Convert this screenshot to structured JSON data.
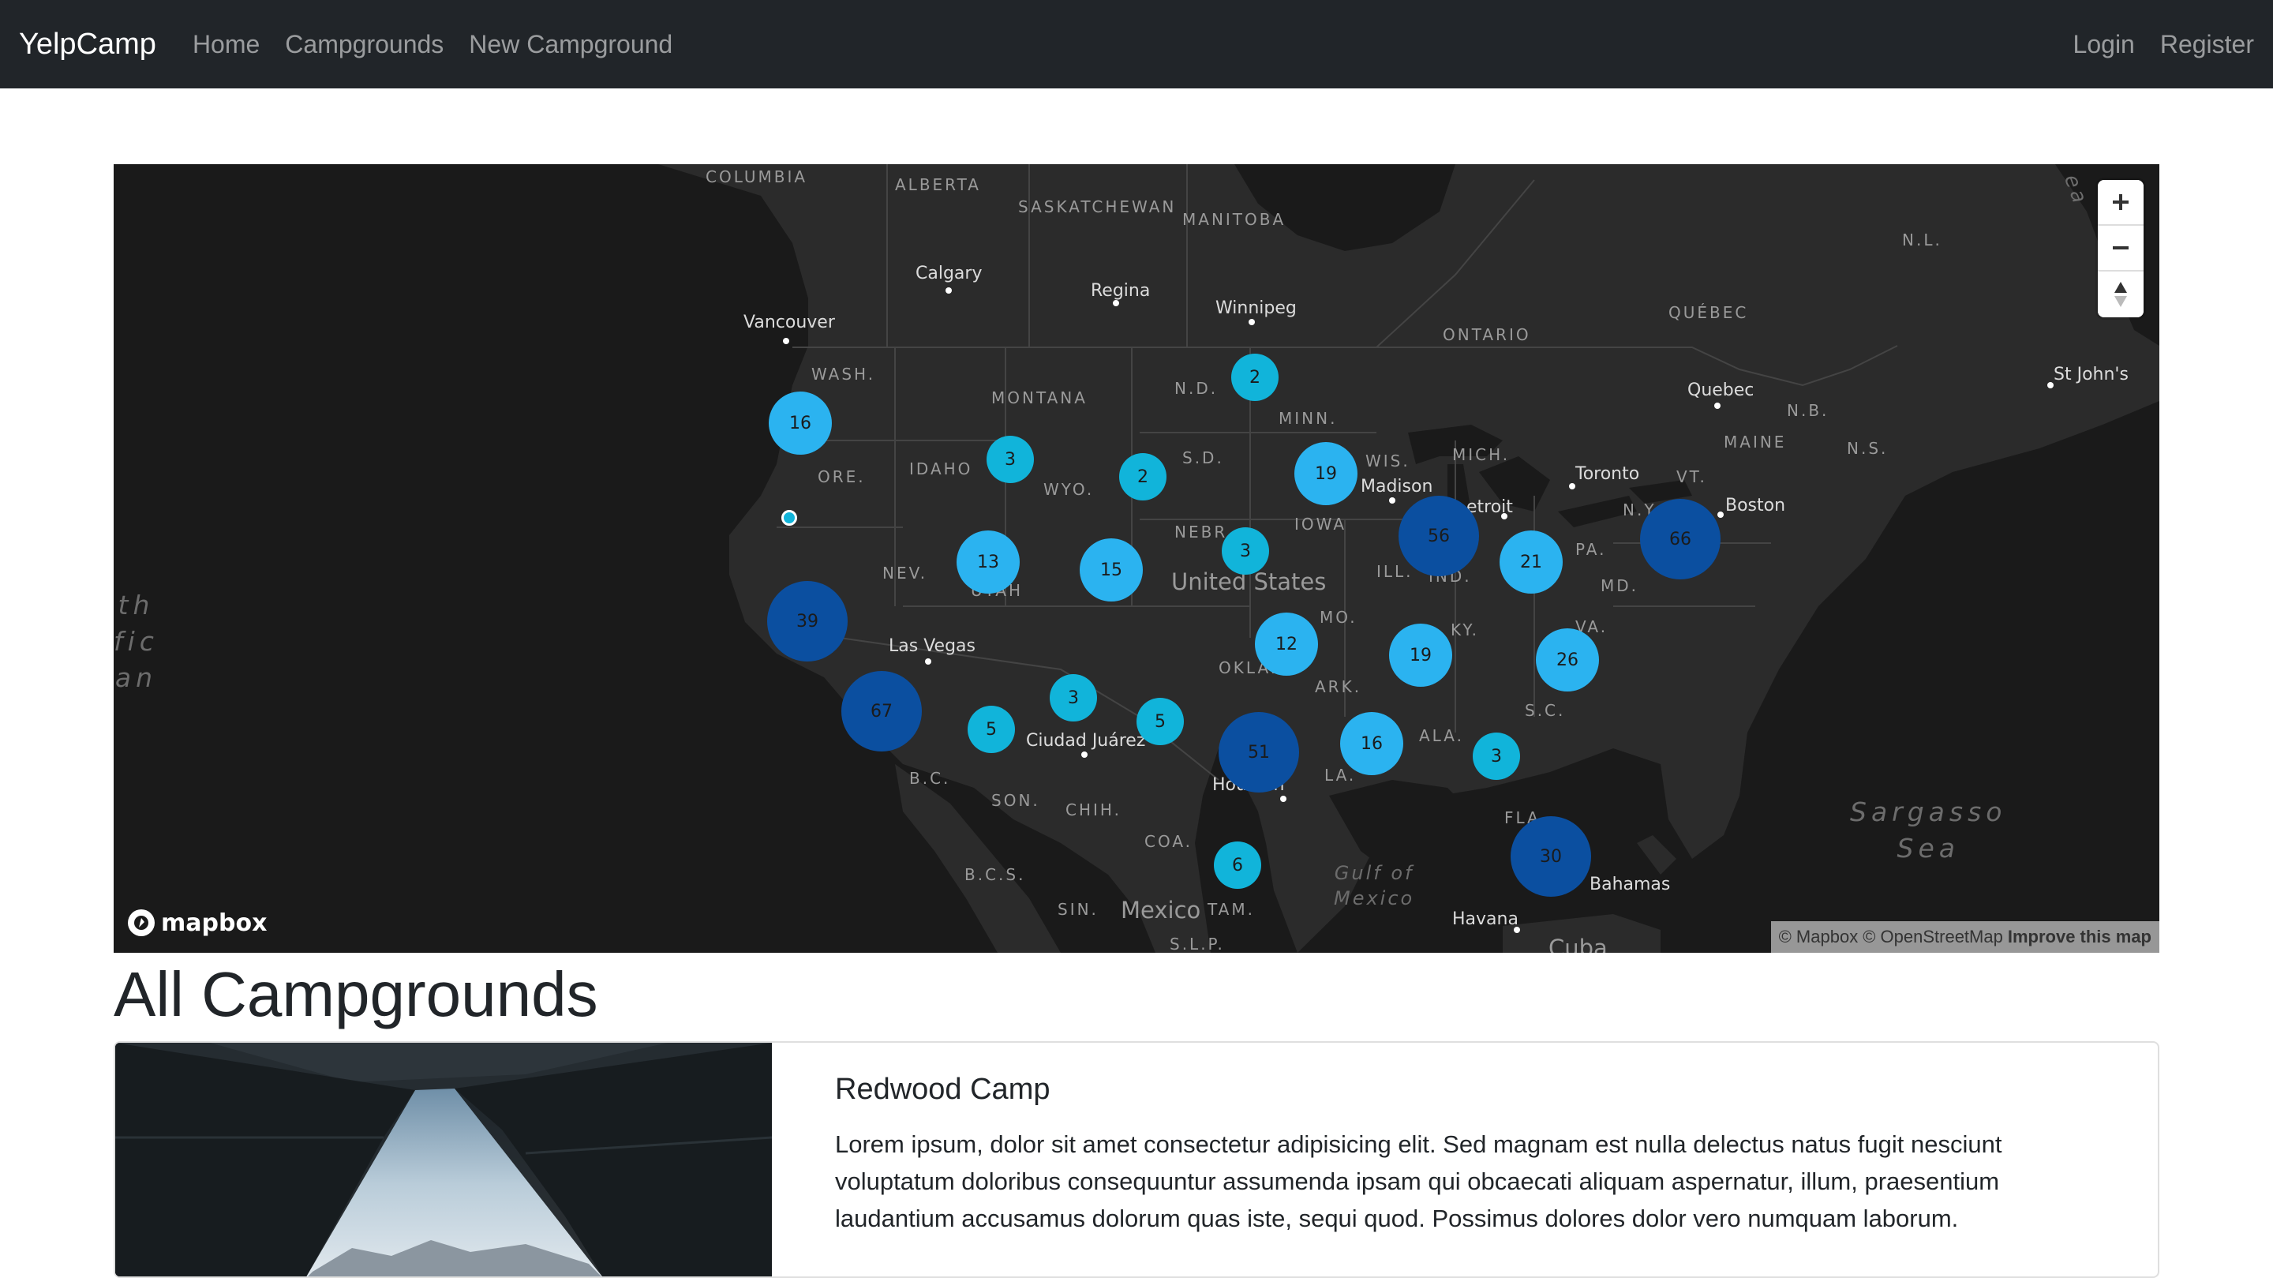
{
  "nav": {
    "brand": "YelpCamp",
    "links": [
      "Home",
      "Campgrounds",
      "New Campground"
    ],
    "right_links": [
      "Login",
      "Register"
    ]
  },
  "map": {
    "labels": {
      "columbia": "COLUMBIA",
      "alberta": "ALBERTA",
      "saskatchewan": "SASKATCHEWAN",
      "manitoba": "MANITOBA",
      "ontario": "ONTARIO",
      "quebec_prov": "QUÉBEC",
      "nl": "N.L.",
      "nb": "N.B.",
      "ns": "N.S.",
      "maine": "MAINE",
      "vt": "VT.",
      "ny": "N.Y.",
      "pa": "PA.",
      "md": "MD.",
      "va": "VA.",
      "wash": "WASH.",
      "montana": "MONTANA",
      "nd": "N.D.",
      "minn": "MINN.",
      "ore": "ORE.",
      "idaho": "IDAHO",
      "wyo": "WYO.",
      "sd": "S.D.",
      "wis": "WIS.",
      "mich": "MICH.",
      "iowa": "IOWA",
      "nebr": "NEBR.",
      "nev": "NEV.",
      "utah": "UTAH",
      "ill": "ILL.",
      "ind": "IND.",
      "ky": "KY.",
      "mo": "MO.",
      "okla": "OKLA.",
      "ark": "ARK.",
      "sc": "S.C.",
      "ala": "ALA.",
      "la": "LA.",
      "fla": "FLA.",
      "bc": "B.C.",
      "son": "SON.",
      "chih": "CHIH.",
      "coa": "COA.",
      "bcs": "B.C.S.",
      "sin": "SIN.",
      "tam": "TAM.",
      "slp": "S.L.P."
    },
    "cities": {
      "calgary": "Calgary",
      "regina": "Regina",
      "winnipeg": "Winnipeg",
      "vancouver": "Vancouver",
      "quebec": "Quebec",
      "stjohns": "St John's",
      "toronto": "Toronto",
      "boston": "Boston",
      "madison": "Madison",
      "detroit": "etroit",
      "lasvegas": "Las Vegas",
      "ciudadjuarez": "Ciudad Juárez",
      "houston": "Houston",
      "havana": "Havana",
      "bahamas": "Bahamas",
      "cuba": "Cuba"
    },
    "countries": {
      "us": "United States",
      "mexico": "Mexico"
    },
    "seas": {
      "pacific": "th\nfic\nan",
      "sargasso": "Sargasso\nSea",
      "gulf": "Gulf of\nMexico",
      "labrador": "ea"
    },
    "clusters": [
      "16",
      "2",
      "3",
      "2",
      "19",
      "13",
      "15",
      "3",
      "56",
      "21",
      "66",
      "39",
      "12",
      "19",
      "26",
      "67",
      "3",
      "5",
      "5",
      "51",
      "16",
      "3",
      "6",
      "30"
    ],
    "attribution": {
      "mapbox": "© Mapbox",
      "osm": "© OpenStreetMap",
      "improve": "Improve this map"
    },
    "logo_text": "mapbox",
    "colors": {
      "small": "#51bbd6",
      "medium": "#2bb3f0",
      "large": "#0b4fa0",
      "tiny": "#11b4da"
    }
  },
  "page_title": "All Campgrounds",
  "campgrounds": [
    {
      "title": "Redwood Camp",
      "description": "Lorem ipsum, dolor sit amet consectetur adipisicing elit. Sed magnam est nulla delectus natus fugit nesciunt voluptatum doloribus consequuntur assumenda ipsam qui obcaecati aliquam aspernatur, illum, praesentium laudantium accusamus dolorum quas iste, sequi quod. Possimus dolores dolor vero numquam laborum."
    }
  ]
}
